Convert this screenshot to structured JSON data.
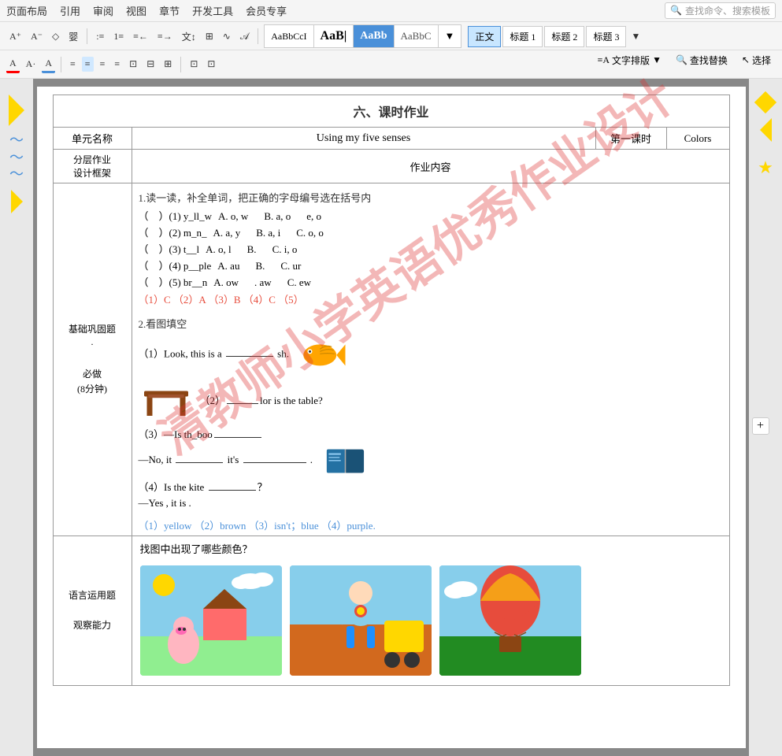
{
  "menubar": {
    "items": [
      "页面布局",
      "引用",
      "审阅",
      "视图",
      "章节",
      "开发工具",
      "会员专享"
    ],
    "search_placeholder": "查找命令、搜索模板"
  },
  "toolbar1": {
    "font_size_up": "A",
    "font_size_down": "A",
    "diamond": "◇",
    "special": "婴",
    "list_items": [
      "≡",
      "≡",
      "≡",
      "≡",
      "≡",
      "𝒜",
      "𝒜",
      "∿",
      "𝒜",
      "⊟"
    ],
    "style_normal": "正文",
    "style_h1": "标题 1",
    "style_h2": "标题 2",
    "style_h3": "标题 3",
    "more": "▼",
    "text_layout": "文字排版",
    "find_replace": "查找替换",
    "select": "选择"
  },
  "toolbar2": {
    "align_left": "≡",
    "align_center": "≡",
    "align_right": "≡",
    "justify": "≡",
    "distributed": "≡",
    "indent_dec": "⊟",
    "indent_inc": "⊞",
    "line_spacing": "≡",
    "sort": "↕",
    "border": "⊞"
  },
  "section": {
    "title": "六、课时作业"
  },
  "table": {
    "header": {
      "unit_label": "单元名称",
      "unit_value": "Using my five senses",
      "period_label": "第一课时",
      "colors_label": "Colors"
    },
    "subheader": {
      "layer_label": "分层作业\n设计框架",
      "homework_label": "作业内容"
    },
    "left_labels": {
      "foundation": "基础巩固题",
      "dot": "·",
      "required": "必做",
      "time": "(8分钟)"
    },
    "exercise1": {
      "title": "1.读一读，补全单词，把正确的字母编号选在括号内",
      "items": [
        {
          "num": "(1)",
          "word": "y_ll_w",
          "optA": "A. o, w",
          "optB": "B. a, o",
          "optC": "e, o"
        },
        {
          "num": "(2)",
          "word": "m_n_",
          "optA": "A. a, y",
          "optB": "B. a, i",
          "optC": "C. o, o"
        },
        {
          "num": "(3)",
          "word": "t__l",
          "optA": "A. o, l",
          "optB": "B.",
          "optC": "C. i, o"
        },
        {
          "num": "(4)",
          "word": "p__ple",
          "optA": "A. au",
          "optB": "B.",
          "optC": "C. ur"
        },
        {
          "num": "(5)",
          "word": "br__n",
          "optA": "A. ow",
          "optB": ". aw",
          "optC": "C. ew"
        }
      ],
      "answer": "（1）C （2）A （3）B （4）C （5）"
    },
    "exercise2": {
      "title": "2.看图填空",
      "items": [
        {
          "num": "(1)",
          "text": "Look, this is a",
          "blank": "______",
          "suffix": "sh."
        },
        {
          "num": "(2)",
          "text": "",
          "blank": "",
          "suffix": "lor is the table?"
        },
        {
          "num": "(3)",
          "text": "—Is th_boo",
          "blank": "____",
          "suffix": ""
        },
        {
          "num": "",
          "text": "—No, it",
          "blank": "___",
          "suffix": "it's",
          "blank2": "____________",
          "end": "."
        },
        {
          "num": "(4)",
          "text": "Is the kite",
          "blank": "_______",
          "suffix": "?"
        },
        {
          "num": "",
          "text": "—Yes , it is .",
          "blank": "",
          "suffix": ""
        }
      ],
      "answer": "（1）yellow （2）brown （3）isn't；blue （4）purple."
    },
    "bottom_left_label": "语言运用题",
    "bottom_left_label2": "观察能力",
    "bottom_question": "找图中出现了哪些颜色？"
  }
}
